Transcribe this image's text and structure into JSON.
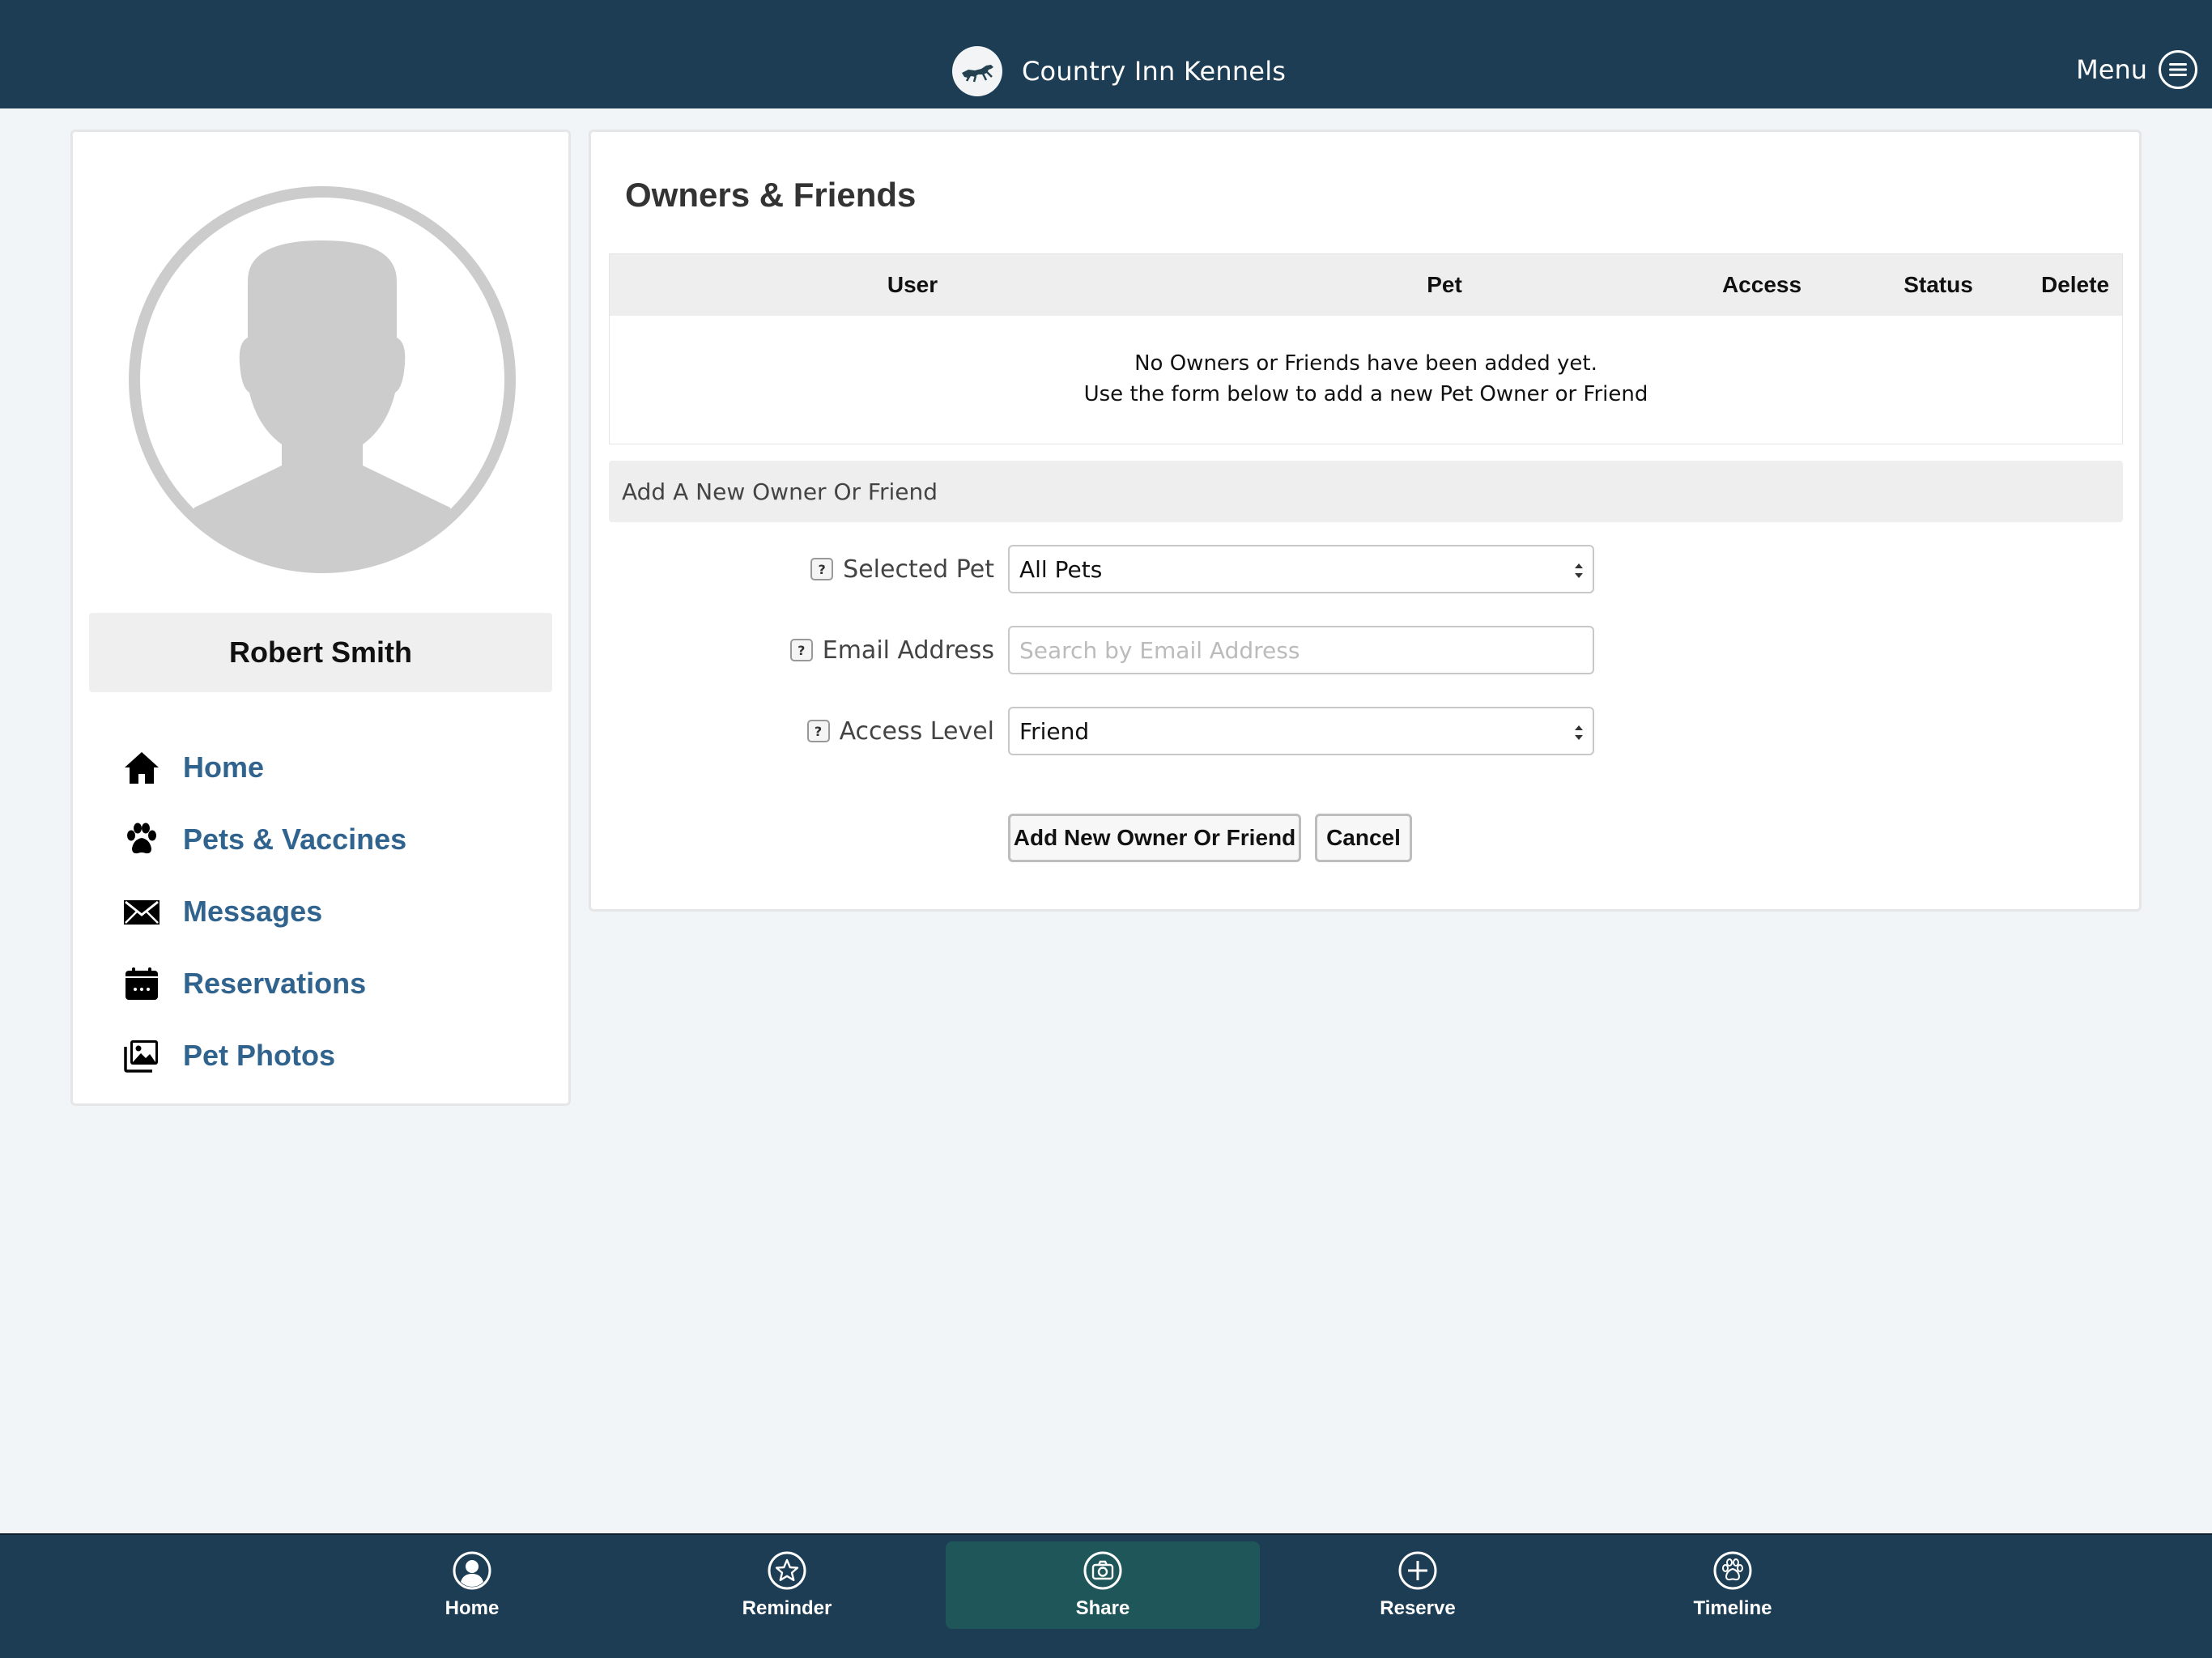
{
  "header": {
    "app_title": "Country Inn Kennels",
    "menu_label": "Menu"
  },
  "profile": {
    "name": "Robert Smith"
  },
  "sidebar": {
    "items": [
      {
        "label": "Home",
        "icon": "home-icon"
      },
      {
        "label": "Pets & Vaccines",
        "icon": "paw-icon"
      },
      {
        "label": "Messages",
        "icon": "envelope-icon"
      },
      {
        "label": "Reservations",
        "icon": "calendar-icon"
      },
      {
        "label": "Pet Photos",
        "icon": "photos-icon"
      }
    ]
  },
  "main": {
    "title": "Owners & Friends",
    "table": {
      "columns": [
        "User",
        "Pet",
        "Access",
        "Status",
        "Delete"
      ],
      "empty_line1": "No Owners or Friends have been added yet.",
      "empty_line2": "Use the form below to add a new Pet Owner or Friend"
    },
    "form": {
      "section_title": "Add A New Owner Or Friend",
      "help_glyph": "?",
      "selected_pet_label": "Selected Pet",
      "selected_pet_value": "All Pets",
      "email_label": "Email Address",
      "email_placeholder": "Search by Email Address",
      "access_label": "Access Level",
      "access_value": "Friend",
      "submit_label": "Add New Owner Or Friend",
      "cancel_label": "Cancel"
    }
  },
  "tabbar": {
    "items": [
      {
        "label": "Home",
        "icon": "user-circle-icon"
      },
      {
        "label": "Reminder",
        "icon": "star-icon"
      },
      {
        "label": "Share",
        "icon": "camera-icon",
        "active": true
      },
      {
        "label": "Reserve",
        "icon": "plus-circle-icon"
      },
      {
        "label": "Timeline",
        "icon": "paw-circle-icon"
      }
    ]
  },
  "colors": {
    "header_bg": "#1c3d54",
    "active_tab_bg": "#1e5659",
    "nav_link": "#30638e",
    "page_bg": "#f1f5f8"
  }
}
